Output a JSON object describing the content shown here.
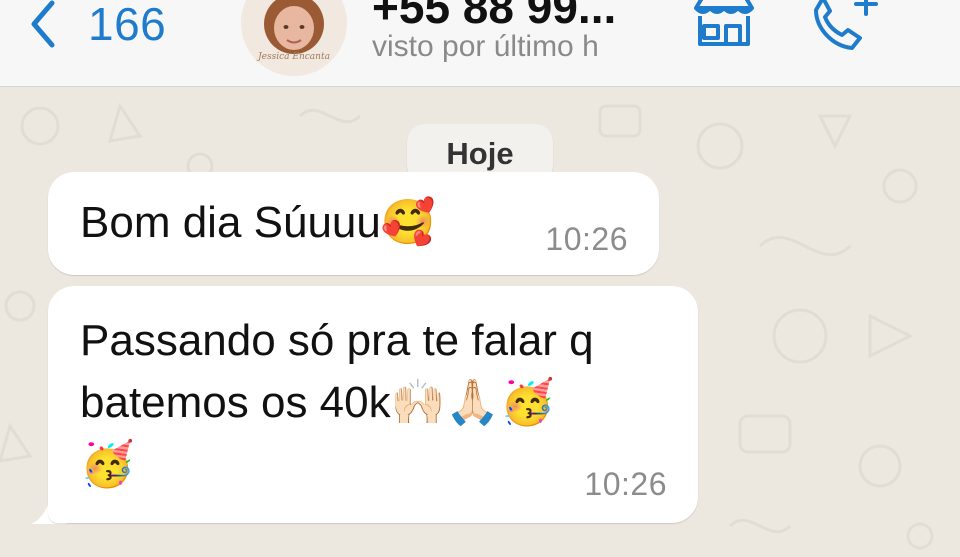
{
  "header": {
    "back_count": "166",
    "contact_name": "+55 88 99...",
    "contact_status": "visto por último h",
    "avatar_caption": "Jessica Encanta",
    "icons": [
      "chevron-left-icon",
      "store-icon",
      "phone-add-icon"
    ]
  },
  "chat": {
    "date_label": "Hoje",
    "messages": [
      {
        "text_lines": [
          "Bom dia Súuuu🥰"
        ],
        "time": "10:26"
      },
      {
        "text_lines": [
          "Passando só pra te falar q",
          "batemos os 40k🙌🏻🙏🏻🥳",
          "🥳"
        ],
        "time": "10:26"
      }
    ]
  },
  "colors": {
    "accent": "#1f7ccc",
    "wallpaper": "#efeae2",
    "bubble": "#ffffff",
    "header_bg": "#f7f7f7",
    "time_text": "#8c8c8c"
  }
}
